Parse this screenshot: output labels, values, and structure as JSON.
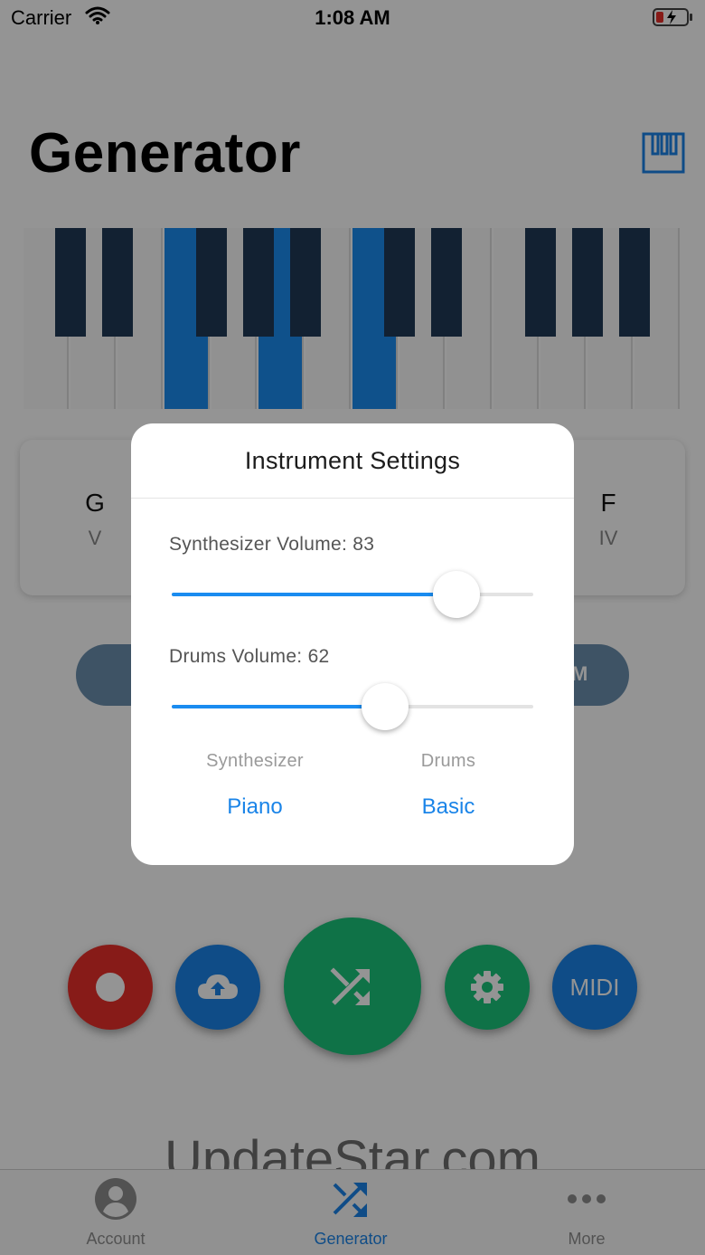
{
  "status_bar": {
    "carrier": "Carrier",
    "time": "1:08 AM"
  },
  "header": {
    "title": "Generator",
    "keyboard_icon": "piano-keys-icon"
  },
  "piano": {
    "white_keys": 14,
    "active_white_keys": [
      3,
      5,
      7
    ]
  },
  "chords": [
    {
      "name": "G",
      "numeral": "V"
    },
    {
      "name": "F",
      "numeral": "IV"
    }
  ],
  "pill_right_label": "M",
  "fabs": {
    "record_icon": "record-icon",
    "upload_icon": "cloud-upload-icon",
    "shuffle_icon": "shuffle-icon",
    "settings_icon": "gear-icon",
    "midi_label": "MIDI"
  },
  "watermark": "UpdateStar.com",
  "tabs": [
    {
      "label": "Account",
      "icon": "account-icon"
    },
    {
      "label": "Generator",
      "icon": "shuffle-icon",
      "active": true
    },
    {
      "label": "More",
      "icon": "more-icon"
    }
  ],
  "dialog": {
    "title": "Instrument Settings",
    "synth_volume": {
      "label": "Synthesizer Volume: 83",
      "value": 83,
      "max": 100
    },
    "drums_volume": {
      "label": "Drums Volume: 62",
      "value": 62,
      "max": 100
    },
    "synth_picker": {
      "caption": "Synthesizer",
      "value": "Piano"
    },
    "drums_picker": {
      "caption": "Drums",
      "value": "Basic"
    }
  },
  "colors": {
    "accent_blue": "#1a84e8",
    "green": "#1bc47a",
    "red": "#e8302a"
  }
}
